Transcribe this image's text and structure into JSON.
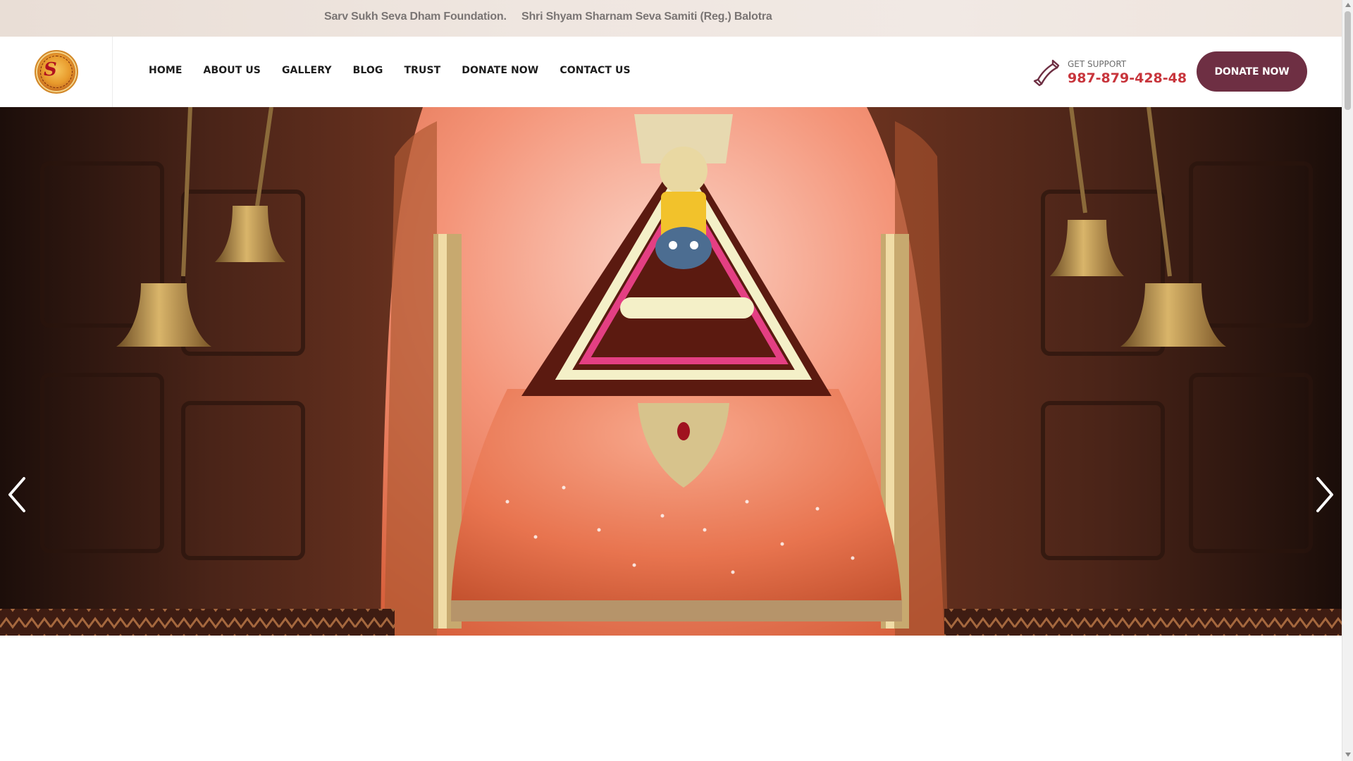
{
  "topbar": {
    "ticker_1": "Sarv Sukh Seva Dham Foundation.",
    "ticker_2": "Shri Shyam Sharnam Seva Samiti (Reg.) Balotra"
  },
  "header": {
    "logo_icon": "temple-logo-icon",
    "nav": [
      {
        "label": "HOME"
      },
      {
        "label": "ABOUT US"
      },
      {
        "label": "GALLERY"
      },
      {
        "label": "BLOG"
      },
      {
        "label": "TRUST"
      },
      {
        "label": "DONATE NOW"
      },
      {
        "label": "CONTACT US"
      }
    ],
    "support": {
      "icon": "phone-icon",
      "label": "GET SUPPORT",
      "number": "987-879-428-48"
    },
    "donate_button": "DONATE NOW"
  },
  "hero": {
    "slide_image": "temple-shrine-with-bells-image",
    "prev_icon": "chevron-left-icon",
    "next_icon": "chevron-right-icon"
  },
  "colors": {
    "accent": "#6e2f43",
    "support_number": "#c8353c",
    "topbar_bg": "#efe6e0",
    "ticker_text": "#7a7574"
  }
}
